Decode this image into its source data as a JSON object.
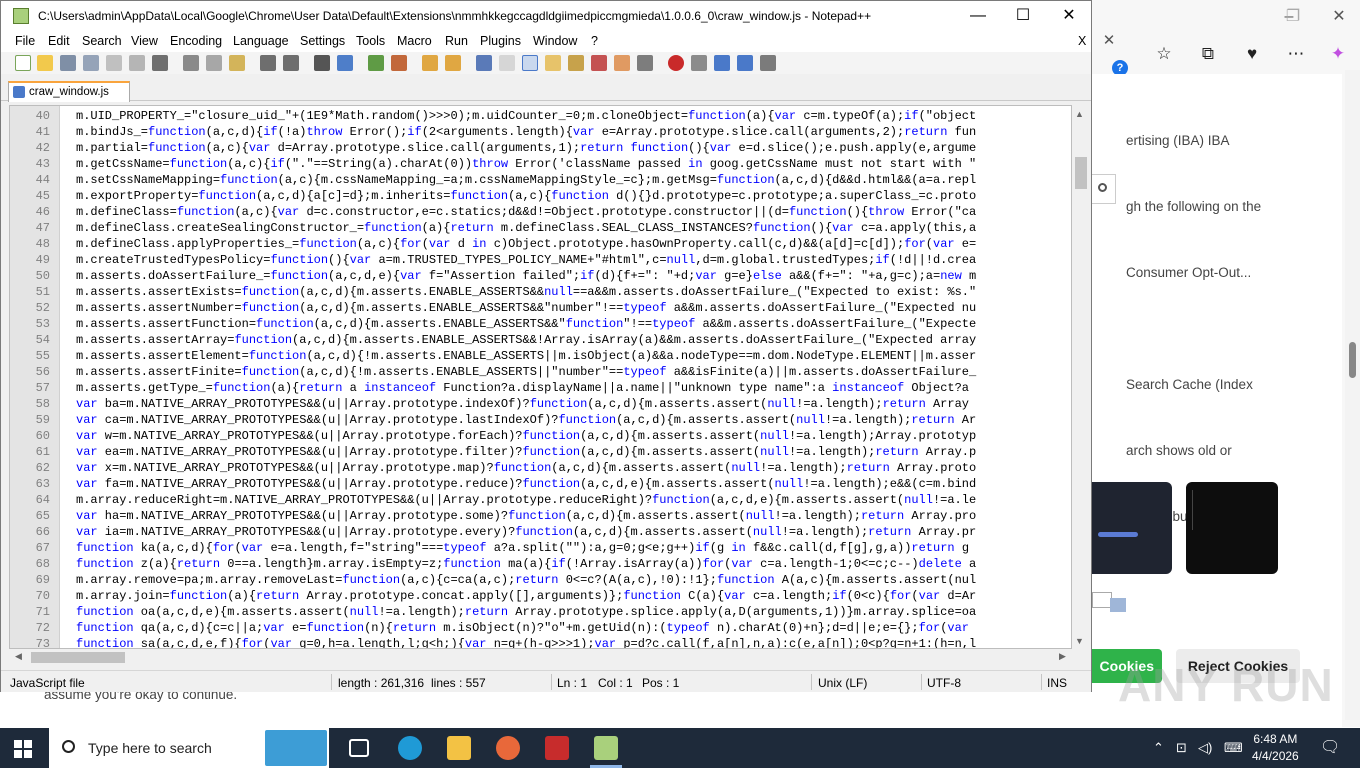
{
  "notepad": {
    "title": "C:\\Users\\admin\\AppData\\Local\\Google\\Chrome\\User Data\\Default\\Extensions\\nmmhkkegccagdldgiimedpiccmgmieda\\1.0.0.6_0\\craw_window.js - Notepad++",
    "menu": [
      "File",
      "Edit",
      "Search",
      "View",
      "Encoding",
      "Language",
      "Settings",
      "Tools",
      "Macro",
      "Run",
      "Plugins",
      "Window",
      "?"
    ],
    "close_doc": "X",
    "tab_label": "craw_window.js",
    "status": {
      "type": "JavaScript file",
      "length": "length : 261,316",
      "lines": "lines : 557",
      "ln": "Ln : 1",
      "col": "Col : 1",
      "pos": "Pos : 1",
      "eol": "Unix (LF)",
      "encoding": "UTF-8",
      "mode": "INS"
    }
  },
  "code_lines": [
    {
      "n": "40",
      "t": "m.UID_PROPERTY_=\"closure_uid_\"+(1E9*Math.random()>>>0);m.uidCounter_=0;m.cloneObject=function(a){var c=m.typeOf(a);if(\"object"
    },
    {
      "n": "41",
      "t": "m.bindJs_=function(a,c,d){if(!a)throw Error();if(2<arguments.length){var e=Array.prototype.slice.call(arguments,2);return fun"
    },
    {
      "n": "42",
      "t": "m.partial=function(a,c){var d=Array.prototype.slice.call(arguments,1);return function(){var e=d.slice();e.push.apply(e,argume"
    },
    {
      "n": "43",
      "t": "m.getCssName=function(a,c){if(\".\"==String(a).charAt(0))throw Error('className passed in goog.getCssName must not start with \""
    },
    {
      "n": "44",
      "t": "m.setCssNameMapping=function(a,c){m.cssNameMapping_=a;m.cssNameMappingStyle_=c};m.getMsg=function(a,c,d){d&&d.html&&(a=a.repl"
    },
    {
      "n": "45",
      "t": "m.exportProperty=function(a,c,d){a[c]=d};m.inherits=function(a,c){function d(){}d.prototype=c.prototype;a.superClass_=c.proto"
    },
    {
      "n": "46",
      "t": "m.defineClass=function(a,c){var d=c.constructor,e=c.statics;d&&d!=Object.prototype.constructor||(d=function(){throw Error(\"ca"
    },
    {
      "n": "47",
      "t": "m.defineClass.createSealingConstructor_=function(a){return m.defineClass.SEAL_CLASS_INSTANCES?function(){var c=a.apply(this,a"
    },
    {
      "n": "48",
      "t": "m.defineClass.applyProperties_=function(a,c){for(var d in c)Object.prototype.hasOwnProperty.call(c,d)&&(a[d]=c[d]);for(var e="
    },
    {
      "n": "49",
      "t": "m.createTrustedTypesPolicy=function(){var a=m.TRUSTED_TYPES_POLICY_NAME+\"#html\",c=null,d=m.global.trustedTypes;if(!d||!d.crea"
    },
    {
      "n": "50",
      "t": "m.asserts.doAssertFailure_=function(a,c,d,e){var f=\"Assertion failed\";if(d){f+=\": \"+d;var g=e}else a&&(f+=\": \"+a,g=c);a=new m"
    },
    {
      "n": "51",
      "t": "m.asserts.assertExists=function(a,c,d){m.asserts.ENABLE_ASSERTS&&null==a&&m.asserts.doAssertFailure_(\"Expected to exist: %s.\""
    },
    {
      "n": "52",
      "t": "m.asserts.assertNumber=function(a,c,d){m.asserts.ENABLE_ASSERTS&&\"number\"!==typeof a&&m.asserts.doAssertFailure_(\"Expected nu"
    },
    {
      "n": "53",
      "t": "m.asserts.assertFunction=function(a,c,d){m.asserts.ENABLE_ASSERTS&&\"function\"!==typeof a&&m.asserts.doAssertFailure_(\"Expecte"
    },
    {
      "n": "54",
      "t": "m.asserts.assertArray=function(a,c,d){m.asserts.ENABLE_ASSERTS&&!Array.isArray(a)&&m.asserts.doAssertFailure_(\"Expected array"
    },
    {
      "n": "55",
      "t": "m.asserts.assertElement=function(a,c,d){!m.asserts.ENABLE_ASSERTS||m.isObject(a)&&a.nodeType==m.dom.NodeType.ELEMENT||m.asser"
    },
    {
      "n": "56",
      "t": "m.asserts.assertFinite=function(a,c,d){!m.asserts.ENABLE_ASSERTS||\"number\"==typeof a&&isFinite(a)||m.asserts.doAssertFailure_"
    },
    {
      "n": "57",
      "t": "m.asserts.getType_=function(a){return a instanceof Function?a.displayName||a.name||\"unknown type name\":a instanceof Object?a"
    },
    {
      "n": "58",
      "t": "var ba=m.NATIVE_ARRAY_PROTOTYPES&&(u||Array.prototype.indexOf)?function(a,c,d){m.asserts.assert(null!=a.length);return Array"
    },
    {
      "n": "59",
      "t": "var ca=m.NATIVE_ARRAY_PROTOTYPES&&(u||Array.prototype.lastIndexOf)?function(a,c,d){m.asserts.assert(null!=a.length);return Ar"
    },
    {
      "n": "60",
      "t": "var w=m.NATIVE_ARRAY_PROTOTYPES&&(u||Array.prototype.forEach)?function(a,c,d){m.asserts.assert(null!=a.length);Array.prototyp"
    },
    {
      "n": "61",
      "t": "var ea=m.NATIVE_ARRAY_PROTOTYPES&&(u||Array.prototype.filter)?function(a,c,d){m.asserts.assert(null!=a.length);return Array.p"
    },
    {
      "n": "62",
      "t": "var x=m.NATIVE_ARRAY_PROTOTYPES&&(u||Array.prototype.map)?function(a,c,d){m.asserts.assert(null!=a.length);return Array.proto"
    },
    {
      "n": "63",
      "t": "var fa=m.NATIVE_ARRAY_PROTOTYPES&&(u||Array.prototype.reduce)?function(a,c,d,e){m.asserts.assert(null!=a.length);e&&(c=m.bind"
    },
    {
      "n": "64",
      "t": "m.array.reduceRight=m.NATIVE_ARRAY_PROTOTYPES&&(u||Array.prototype.reduceRight)?function(a,c,d,e){m.asserts.assert(null!=a.le"
    },
    {
      "n": "65",
      "t": "var ha=m.NATIVE_ARRAY_PROTOTYPES&&(u||Array.prototype.some)?function(a,c,d){m.asserts.assert(null!=a.length);return Array.pro"
    },
    {
      "n": "66",
      "t": "var ia=m.NATIVE_ARRAY_PROTOTYPES&&(u||Array.prototype.every)?function(a,c,d){m.asserts.assert(null!=a.length);return Array.pr"
    },
    {
      "n": "67",
      "t": "function ka(a,c,d){for(var e=a.length,f=\"string\"===typeof a?a.split(\"\"):a,g=0;g<e;g++)if(g in f&&c.call(d,f[g],g,a))return g"
    },
    {
      "n": "68",
      "t": "function z(a){return 0==a.length}m.array.isEmpty=z;function ma(a){if(!Array.isArray(a))for(var c=a.length-1;0<=c;c--)delete a"
    },
    {
      "n": "69",
      "t": "m.array.remove=pa;m.array.removeLast=function(a,c){c=ca(a,c);return 0<=c?(A(a,c),!0):!1};function A(a,c){m.asserts.assert(nul"
    },
    {
      "n": "70",
      "t": "m.array.join=function(a){return Array.prototype.concat.apply([],arguments)};function C(a){var c=a.length;if(0<c){for(var d=Ar"
    },
    {
      "n": "71",
      "t": "function oa(a,c,d,e){m.asserts.assert(null!=a.length);return Array.prototype.splice.apply(a,D(arguments,1))}m.array.splice=oa"
    },
    {
      "n": "72",
      "t": "function qa(a,c,d){c=c||a;var e=function(n){return m.isObject(n)?\"o\"+m.getUid(n):(typeof n).charAt(0)+n};d=d||e;e={};for(var"
    },
    {
      "n": "73",
      "t": "function sa(a,c,d,e,f){for(var g=0,h=a.length,l;g<h;){var n=g+(h-g>>>1);var p=d?c.call(f,a[n],n,a):c(e,a[n]);0<p?g=n+1:(h=n,l"
    }
  ],
  "edge": {
    "para1": [
      "ertising (IBA) IBA",
      "gh the following on the",
      "Consumer Opt-Out..."
    ],
    "para2": [
      "Search Cache (Index",
      "arch shows old or",
      "## **Rebuild the..."
    ],
    "accept_label": "Cookies",
    "reject_label": "Reject Cookies"
  },
  "background_text": "assume you're okay to continue.",
  "taskbar": {
    "search_placeholder": "Type here to search",
    "time": "6:48 AM",
    "date": "4/4/2026"
  },
  "watermark": "ANY RUN",
  "colors": {
    "keyword": "#0000ff",
    "accent": "#f9a43d",
    "taskbar": "#1e2a3a"
  }
}
